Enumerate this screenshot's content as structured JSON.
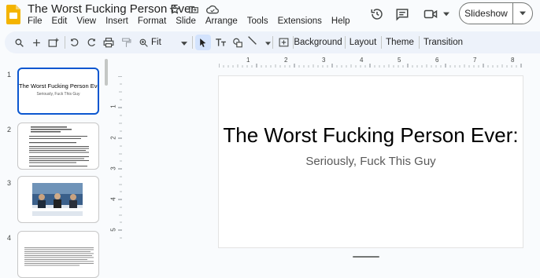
{
  "app": {
    "doc_title": "The Worst Fucking Person Ever",
    "menu": [
      "File",
      "Edit",
      "View",
      "Insert",
      "Format",
      "Slide",
      "Arrange",
      "Tools",
      "Extensions",
      "Help"
    ],
    "slideshow_label": "Slideshow",
    "icons": [
      "star-icon",
      "move-to-folder-icon",
      "cloud-status-icon",
      "history-icon",
      "comments-icon",
      "video-call-icon",
      "chevron-down-icon"
    ]
  },
  "toolbar": {
    "zoom_value": "Fit",
    "background_label": "Background",
    "layout_label": "Layout",
    "theme_label": "Theme",
    "transition_label": "Transition"
  },
  "filmstrip": {
    "slides": [
      {
        "number": "1",
        "title": "The Worst Fucking Person Ever:",
        "subtitle": "Seriously, Fuck This Guy"
      },
      {
        "number": "2"
      },
      {
        "number": "3"
      },
      {
        "number": "4"
      }
    ]
  },
  "rulers": {
    "h_labels": [
      "1",
      "2",
      "3",
      "4",
      "5",
      "6",
      "7",
      "8"
    ],
    "v_labels": [
      "1",
      "2",
      "3",
      "4",
      "5"
    ]
  },
  "slide": {
    "title": "The Worst Fucking Person Ever:",
    "subtitle": "Seriously, Fuck This Guy"
  },
  "colors": {
    "accent": "#0b57d0",
    "slides_logo": "#f4b400",
    "toolbar_bg": "#edf2fa"
  }
}
